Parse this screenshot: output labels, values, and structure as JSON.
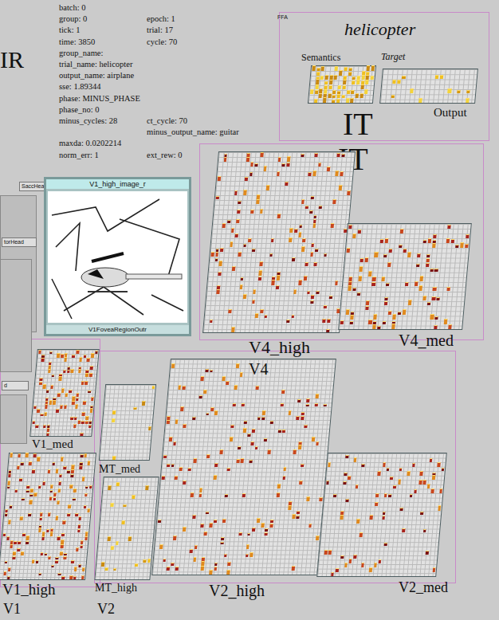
{
  "network_title": "IR",
  "status": [
    {
      "left": "batch: 0"
    },
    {
      "left": "group: 0",
      "right": "epoch: 1"
    },
    {
      "left": "tick: 1",
      "right": "trial: 17"
    },
    {
      "left": "time: 3850",
      "right": "cycle: 70"
    },
    {
      "left": "group_name:"
    },
    {
      "left": "trial_name: helicopter"
    },
    {
      "left": "output_name: airplane"
    },
    {
      "left": "sse: 1.89344"
    },
    {
      "left": "phase: MINUS_PHASE"
    },
    {
      "left": "phase_no: 0"
    },
    {
      "left": "minus_cycles: 28",
      "right": "ct_cycle: 70"
    },
    {
      "right": "minus_output_name: guitar"
    },
    {
      "left": "maxda: 0.0202214"
    },
    {
      "left": "norm_err: 1",
      "right": "ext_rew: 0"
    }
  ],
  "it_group": {
    "ffa": "FFA",
    "target_name": "helicopter",
    "target_label": "Target",
    "labels": [
      "IT",
      "IT"
    ]
  },
  "layers": [
    {
      "name": "Semantics",
      "activity": 0.55
    },
    {
      "name": "Output",
      "activity": 0.08
    },
    {
      "name": "V4_high",
      "activity": 0.12
    },
    {
      "name": "V4_med",
      "activity": 0.14
    },
    {
      "name": "V1_med",
      "activity": 0.22
    },
    {
      "name": "V1_high",
      "activity": 0.18
    },
    {
      "name": "MT_med",
      "activity": 0.05
    },
    {
      "name": "MT_high",
      "activity": 0.05
    },
    {
      "name": "V2_high",
      "activity": 0.07
    },
    {
      "name": "V2_med",
      "activity": 0.07
    }
  ],
  "image_view": {
    "title": "V1_high_image_r",
    "caption": "V1FoveaRegionOutr"
  },
  "side_layers": [
    {
      "name": "SaccHead"
    },
    {
      "name": "torHead"
    },
    {
      "name": "d"
    }
  ],
  "group_labels": [
    {
      "name": "V4"
    },
    {
      "name": "V1"
    },
    {
      "name": "V2"
    }
  ]
}
